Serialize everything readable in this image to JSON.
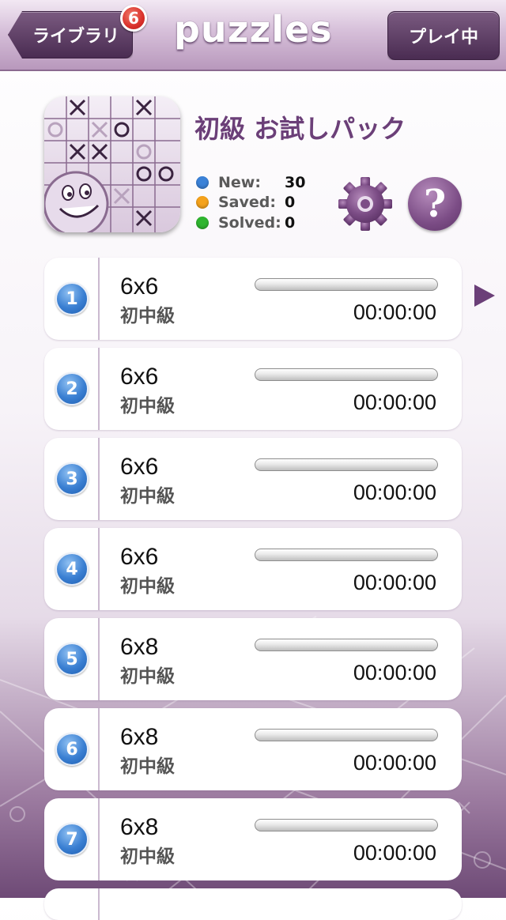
{
  "header": {
    "back_label": "ライブラリ",
    "back_badge": "6",
    "app_title": "puzzles",
    "play_label": "プレイ中"
  },
  "pack": {
    "title": "初級 お試しパック",
    "icon": "puzzle-pack-icon",
    "stats": [
      {
        "label": "New:",
        "value": "30",
        "color": "#3b82d8"
      },
      {
        "label": "Saved:",
        "value": "0",
        "color": "#f5a21b"
      },
      {
        "label": "Solved:",
        "value": "0",
        "color": "#2fb52f"
      }
    ],
    "settings_icon": "gear-icon",
    "help_icon": "question-icon",
    "help_glyph": "?"
  },
  "puzzles": [
    {
      "number": "1",
      "size": "6x6",
      "level": "初中級",
      "time": "00:00:00",
      "progress": 0
    },
    {
      "number": "2",
      "size": "6x6",
      "level": "初中級",
      "time": "00:00:00",
      "progress": 0
    },
    {
      "number": "3",
      "size": "6x6",
      "level": "初中級",
      "time": "00:00:00",
      "progress": 0
    },
    {
      "number": "4",
      "size": "6x6",
      "level": "初中級",
      "time": "00:00:00",
      "progress": 0
    },
    {
      "number": "5",
      "size": "6x8",
      "level": "初中級",
      "time": "00:00:00",
      "progress": 0
    },
    {
      "number": "6",
      "size": "6x8",
      "level": "初中級",
      "time": "00:00:00",
      "progress": 0
    },
    {
      "number": "7",
      "size": "6x8",
      "level": "初中級",
      "time": "00:00:00",
      "progress": 0
    }
  ],
  "colors": {
    "accent": "#6b3f78",
    "header_dark": "#4a2c52",
    "badge": "#d9302a",
    "number_badge": "#3a7fd2"
  }
}
